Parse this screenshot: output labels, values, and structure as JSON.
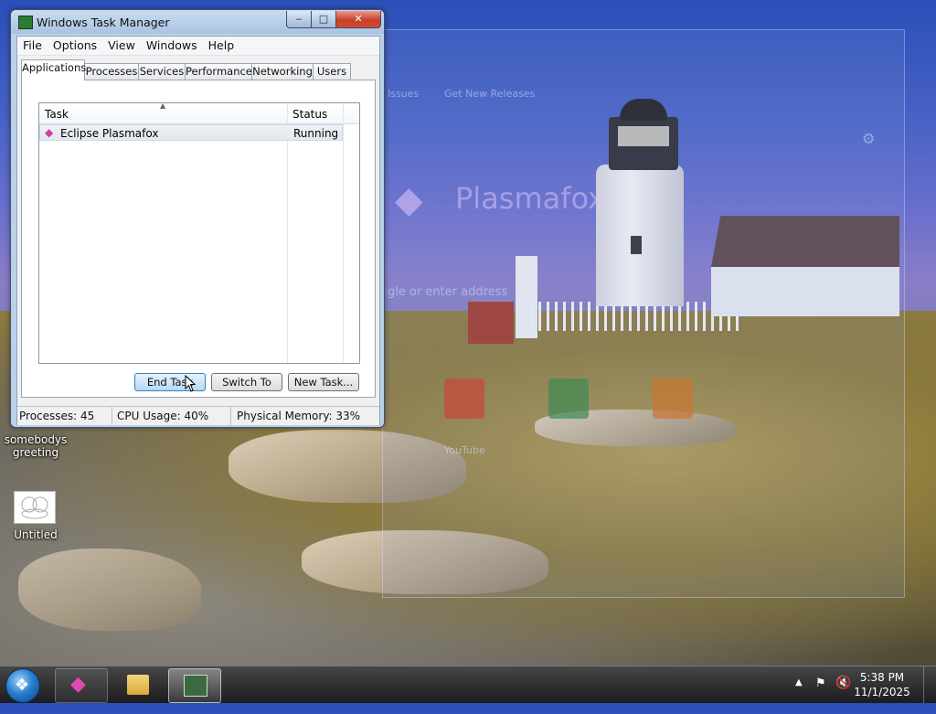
{
  "window": {
    "title": "Windows Task Manager",
    "min": "‒",
    "max": "□",
    "close": "✕"
  },
  "menu": [
    "File",
    "Options",
    "View",
    "Windows",
    "Help"
  ],
  "tabs": [
    "Applications",
    "Processes",
    "Services",
    "Performance",
    "Networking",
    "Users"
  ],
  "list": {
    "headers": {
      "task": "Task",
      "status": "Status"
    },
    "rows": [
      {
        "task": "Eclipse Plasmafox",
        "status": "Running"
      }
    ]
  },
  "buttons": {
    "end_task": "End Task",
    "switch_to": "Switch To",
    "new_task": "New Task..."
  },
  "status": {
    "processes": "Processes: 45",
    "cpu": "CPU Usage: 40%",
    "memory": "Physical Memory: 33%"
  },
  "desktop": {
    "icon1_label_line1": "somebodys",
    "icon1_label_line2": "greeting",
    "icon2_label": "Untitled"
  },
  "background_window": {
    "issues": "Issues",
    "releases": "Get New Releases",
    "brand": "Plasmafox",
    "address_hint": "gle or enter address",
    "tile_youtube": "YouTube"
  },
  "taskbar": {
    "time": "5:38 PM",
    "date": "11/1/2025"
  },
  "colors": {
    "accent_close": "#c7402a",
    "brand_pink": "#d43aa8"
  }
}
